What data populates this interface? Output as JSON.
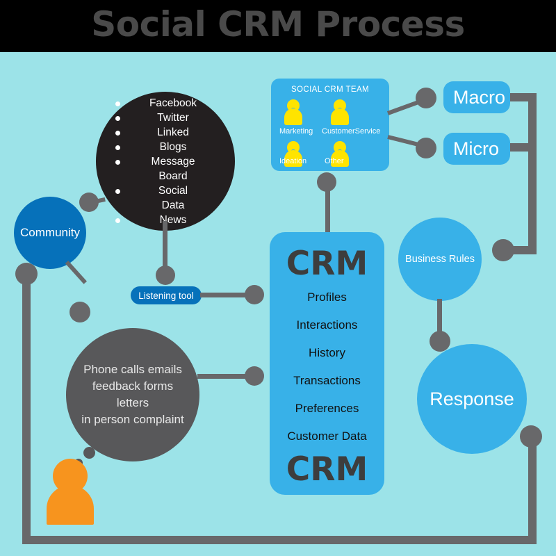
{
  "header": {
    "title": "Social CRM Process"
  },
  "colors": {
    "background": "#9ce3e8",
    "header_band": "#000000",
    "title_text": "#4a4a4a",
    "light_blue": "#38b1e8",
    "dark_blue": "#0671ba",
    "grey": "#58585a",
    "connector_grey": "#68686a",
    "black_circle": "#231f20",
    "yellow_person": "#ffe400",
    "orange_customer": "#f7941e"
  },
  "social_channels": {
    "name": "social-channels-circle",
    "items": [
      "Facebook",
      "Twitter",
      "Linked",
      "Blogs",
      "Message",
      "Board",
      "Social",
      "Data",
      "News"
    ],
    "bulleted": [
      true,
      true,
      true,
      true,
      true,
      false,
      true,
      false,
      true
    ]
  },
  "community": {
    "label": "Community"
  },
  "listening_tool": {
    "label": "Listening tool"
  },
  "offline_channels": {
    "lines": [
      "Phone calls emails",
      "feedback forms letters",
      "in person complaint"
    ]
  },
  "team": {
    "title": "SOCIAL CRM TEAM",
    "members": [
      {
        "label": "Marketing",
        "icon": "person-icon"
      },
      {
        "label": "CustomerService",
        "icon": "person-icon"
      },
      {
        "label": "Ideation",
        "icon": "person-icon"
      },
      {
        "label": "Other",
        "icon": "person-icon"
      }
    ]
  },
  "scope_boxes": [
    {
      "label": "Macro"
    },
    {
      "label": "Micro"
    }
  ],
  "crm": {
    "title_top": "CRM",
    "title_bottom": "CRM",
    "items": [
      "Profiles",
      "Interactions",
      "History",
      "Transactions",
      "Preferences",
      "Customer Data"
    ]
  },
  "business_rules": {
    "label": "Business Rules"
  },
  "response": {
    "label": "Response"
  },
  "customer": {
    "icon": "customer-person-icon"
  }
}
